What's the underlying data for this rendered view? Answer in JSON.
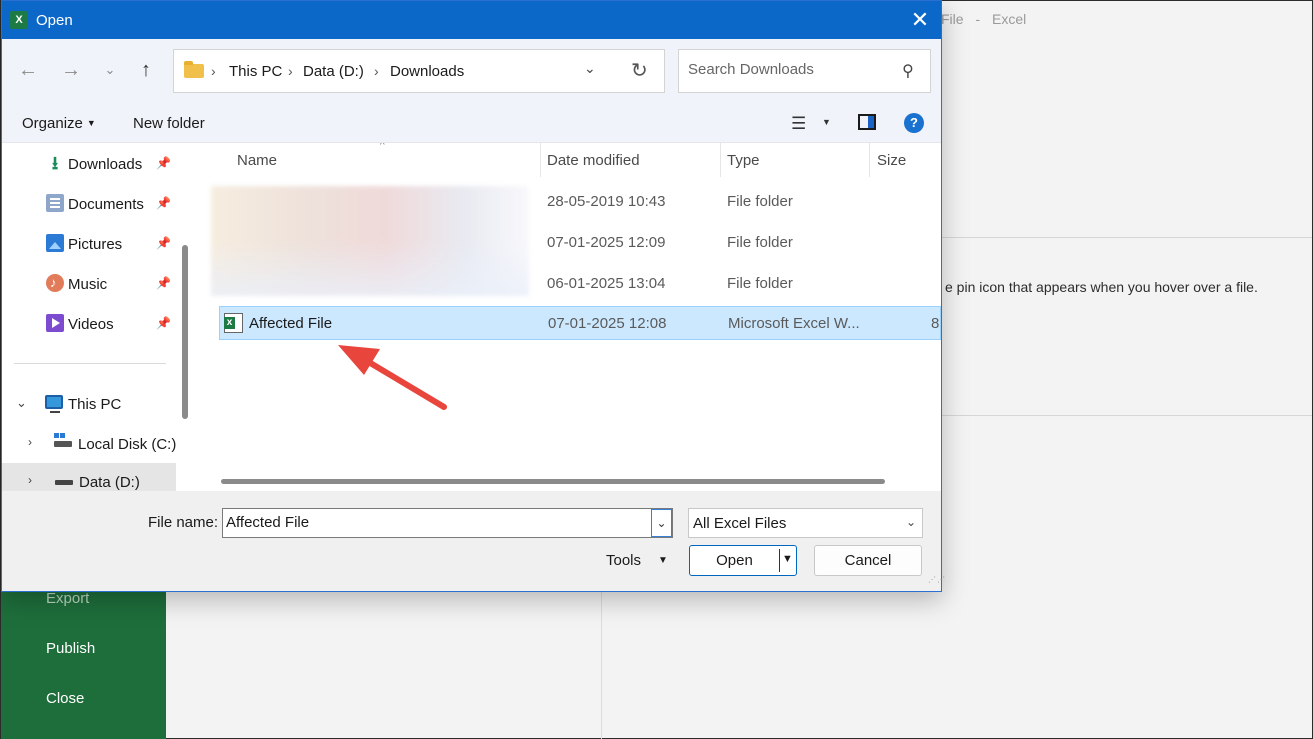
{
  "background": {
    "title_parts": [
      "File",
      "-",
      "Excel"
    ],
    "hint_text": "e pin icon that appears when you hover over a file.",
    "sidebar": [
      "Export",
      "Publish",
      "Close"
    ]
  },
  "dialog": {
    "title": "Open",
    "app_icon": "excel-icon",
    "address": {
      "crumbs": [
        "This PC",
        "Data (D:)",
        "Downloads"
      ]
    },
    "search": {
      "placeholder": "Search Downloads"
    },
    "toolbar": {
      "organize": "Organize",
      "new_folder": "New folder"
    },
    "nav": [
      {
        "label": "Downloads",
        "icon": "downloads-icon",
        "pinned": true
      },
      {
        "label": "Documents",
        "icon": "documents-icon",
        "pinned": true
      },
      {
        "label": "Pictures",
        "icon": "pictures-icon",
        "pinned": true
      },
      {
        "label": "Music",
        "icon": "music-icon",
        "pinned": true
      },
      {
        "label": "Videos",
        "icon": "videos-icon",
        "pinned": true
      },
      {
        "label": "This PC",
        "icon": "computer-icon",
        "expanded": true
      },
      {
        "label": "Local Disk (C:)",
        "icon": "local-disk-icon"
      },
      {
        "label": "Data (D:)",
        "icon": "drive-icon",
        "selected": true
      }
    ],
    "columns": [
      "Name",
      "Date modified",
      "Type",
      "Size"
    ],
    "files": [
      {
        "name": "",
        "date": "28-05-2019 10:43",
        "type": "File folder",
        "size": ""
      },
      {
        "name": "",
        "date": "07-01-2025 12:09",
        "type": "File folder",
        "size": ""
      },
      {
        "name": "",
        "date": "06-01-2025 13:04",
        "type": "File folder",
        "size": ""
      },
      {
        "name": "Affected File",
        "date": "07-01-2025 12:08",
        "type": "Microsoft Excel W...",
        "size": "8",
        "selected": true
      }
    ],
    "bottom": {
      "file_name_label": "File name:",
      "file_name_value": "Affected File",
      "filter": "All Excel Files",
      "tools": "Tools",
      "open": "Open",
      "cancel": "Cancel"
    }
  },
  "colors": {
    "titlebar": "#0b68c8",
    "selection": "#cce8ff",
    "excel_green": "#1e6e3b",
    "annotation_arrow": "#e8453c"
  }
}
